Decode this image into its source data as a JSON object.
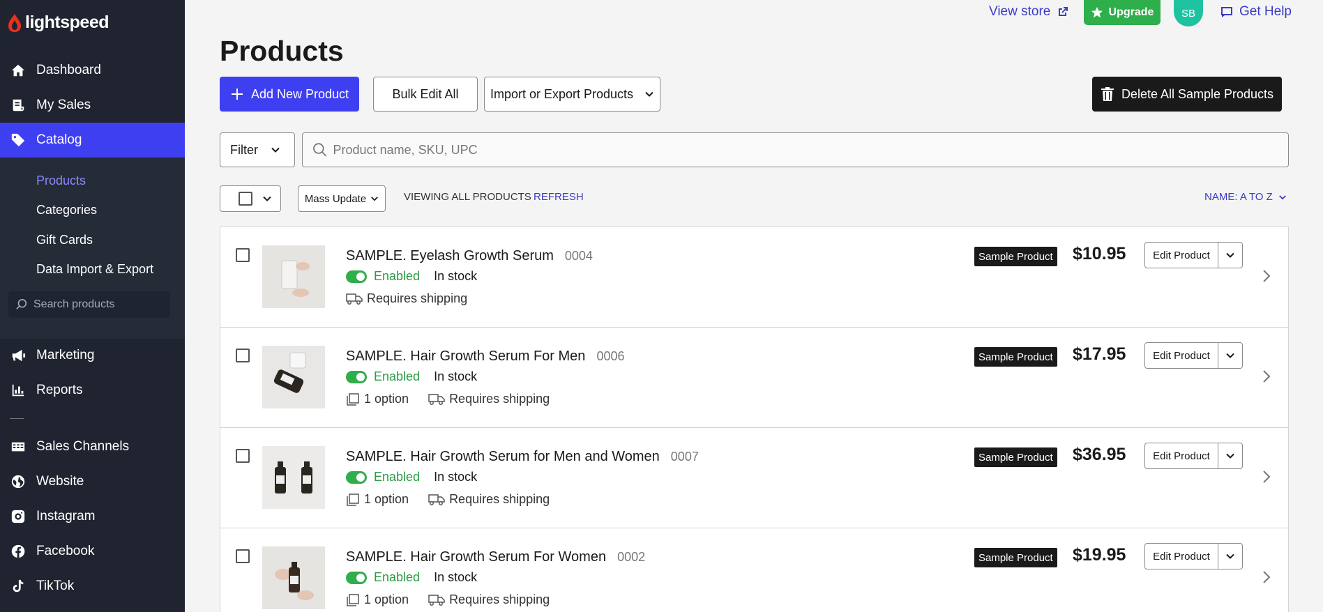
{
  "brand": {
    "name": "lightspeed",
    "accent": "#3f3ff2",
    "sidebar_bg": "#1f2430"
  },
  "header": {
    "view_store": "View store",
    "upgrade": "Upgrade",
    "avatar_initials": "SB",
    "get_help": "Get Help"
  },
  "sidebar": {
    "items": [
      {
        "label": "Dashboard",
        "icon": "home-icon"
      },
      {
        "label": "My Sales",
        "icon": "receipt-icon"
      },
      {
        "label": "Catalog",
        "icon": "tag-icon"
      }
    ],
    "sub_items": [
      {
        "label": "Products"
      },
      {
        "label": "Categories"
      },
      {
        "label": "Gift Cards"
      },
      {
        "label": "Data Import & Export"
      }
    ],
    "search_placeholder": "Search products",
    "lower_items": [
      {
        "label": "Marketing",
        "icon": "megaphone-icon"
      },
      {
        "label": "Reports",
        "icon": "bar-chart-icon"
      },
      {
        "label": "Sales Channels",
        "icon": "channels-icon"
      },
      {
        "label": "Website",
        "icon": "globe-icon"
      },
      {
        "label": "Instagram",
        "icon": "instagram-icon"
      },
      {
        "label": "Facebook",
        "icon": "facebook-icon"
      },
      {
        "label": "TikTok",
        "icon": "tiktok-icon"
      }
    ]
  },
  "page": {
    "title": "Products",
    "add_new": "Add New Product",
    "bulk_edit": "Bulk Edit All",
    "import_export": "Import or Export Products",
    "delete_samples": "Delete All Sample Products",
    "filter": "Filter",
    "search_placeholder": "Product name, SKU, UPC",
    "mass_update": "Mass Update",
    "viewing": "VIEWING ALL PRODUCTS",
    "refresh": "REFRESH",
    "sort": "NAME: A TO Z"
  },
  "products": [
    {
      "name": "SAMPLE. Eyelash Growth Serum",
      "sku": "0004",
      "status": "Enabled",
      "stock": "In stock",
      "option": "",
      "shipping": "Requires shipping",
      "badge": "Sample Product",
      "price": "$10.95",
      "edit": "Edit Product"
    },
    {
      "name": "SAMPLE. Hair Growth Serum For Men",
      "sku": "0006",
      "status": "Enabled",
      "stock": "In stock",
      "option": "1 option",
      "shipping": "Requires shipping",
      "badge": "Sample Product",
      "price": "$17.95",
      "edit": "Edit Product"
    },
    {
      "name": "SAMPLE. Hair Growth Serum for Men and Women",
      "sku": "0007",
      "status": "Enabled",
      "stock": "In stock",
      "option": "1 option",
      "shipping": "Requires shipping",
      "badge": "Sample Product",
      "price": "$36.95",
      "edit": "Edit Product"
    },
    {
      "name": "SAMPLE. Hair Growth Serum For Women",
      "sku": "0002",
      "status": "Enabled",
      "stock": "In stock",
      "option": "1 option",
      "shipping": "Requires shipping",
      "badge": "Sample Product",
      "price": "$19.95",
      "edit": "Edit Product"
    }
  ]
}
